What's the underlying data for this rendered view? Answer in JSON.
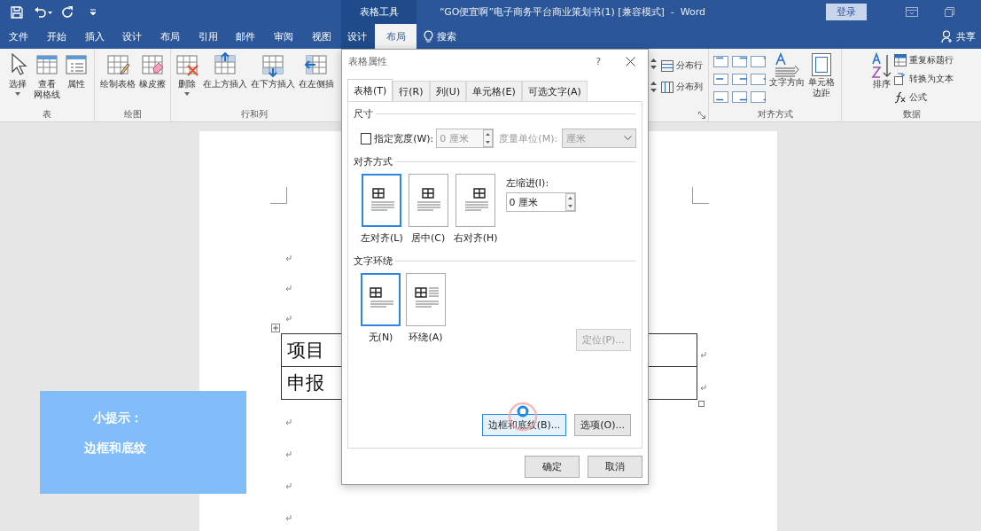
{
  "title_bar": {
    "contextual_header": "表格工具",
    "document_title": "“GO便宜啊”电子商务平台商业策划书(1) [兼容模式]  -  Word",
    "sign_in": "登录"
  },
  "tabs": [
    {
      "label": "文件",
      "selected": false
    },
    {
      "label": "开始",
      "selected": false
    },
    {
      "label": "插入",
      "selected": false
    },
    {
      "label": "设计",
      "selected": false
    },
    {
      "label": "布局",
      "selected": false
    },
    {
      "label": "引用",
      "selected": false
    },
    {
      "label": "邮件",
      "selected": false
    },
    {
      "label": "审阅",
      "selected": false
    },
    {
      "label": "视图",
      "selected": false
    }
  ],
  "contextual_tabs": [
    {
      "label": "设计",
      "selected": false
    },
    {
      "label": "布局",
      "selected": true
    }
  ],
  "tell_me": "搜索",
  "share": "共享",
  "ribbon_left": [
    {
      "label": "表",
      "buttons": [
        {
          "lines": [
            "选择"
          ],
          "dropdown": true
        },
        {
          "lines": [
            "查看",
            "网格线"
          ],
          "dropdown": false
        },
        {
          "lines": [
            "属性"
          ],
          "dropdown": false
        }
      ]
    },
    {
      "label": "绘图",
      "buttons": [
        {
          "lines": [
            "绘制表格"
          ],
          "dropdown": false
        },
        {
          "lines": [
            "橡皮擦"
          ],
          "dropdown": false
        }
      ]
    },
    {
      "label": "行和列",
      "buttons": [
        {
          "lines": [
            "删除"
          ],
          "dropdown": true
        },
        {
          "lines": [
            "在上方插入"
          ],
          "dropdown": false
        },
        {
          "lines": [
            "在下方插入"
          ],
          "dropdown": false
        },
        {
          "lines": [
            "在左侧插"
          ],
          "dropdown": false
        }
      ]
    }
  ],
  "cell_size": {
    "distribute": [
      "分布行",
      "分布列"
    ]
  },
  "alignment": {
    "label": "对齐方式",
    "text_direction": "文字方向",
    "cell_margins": [
      "单元格",
      "边距"
    ]
  },
  "data_group": {
    "label": "数据",
    "sort": "排序",
    "items": [
      "重复标题行",
      "转换为文本",
      "公式"
    ]
  },
  "document": {
    "table_rows": [
      "项目",
      "申报"
    ]
  },
  "tip": {
    "title": "小提示：",
    "text": "边框和底纹"
  },
  "dialog": {
    "title": "表格属性",
    "help": "?",
    "tabs": [
      {
        "label": "表格(T)",
        "selected": true
      },
      {
        "label": "行(R)",
        "selected": false
      },
      {
        "label": "列(U)",
        "selected": false
      },
      {
        "label": "单元格(E)",
        "selected": false
      },
      {
        "label": "可选文字(A)",
        "selected": false
      }
    ],
    "size": {
      "heading": "尺寸",
      "width_label": "指定宽度(W):",
      "checked": false,
      "width_value": "0 厘米",
      "unit_label": "度量单位(M):",
      "unit_value": "厘米",
      "disabled": true
    },
    "alignment": {
      "heading": "对齐方式",
      "options": [
        {
          "label": "左对齐(L)",
          "selected": true
        },
        {
          "label": "居中(C)",
          "selected": false
        },
        {
          "label": "右对齐(H)",
          "selected": false
        }
      ],
      "indent_label": "左缩进(I):",
      "indent_value": "0 厘米"
    },
    "wrapping": {
      "heading": "文字环绕",
      "options": [
        {
          "label": "无(N)",
          "selected": true
        },
        {
          "label": "环绕(A)",
          "selected": false
        }
      ]
    },
    "position_button": {
      "label": "定位(P)...",
      "disabled": true
    },
    "buttons": [
      {
        "label": "边框和底纹(B)...",
        "focused": true
      },
      {
        "label": "选项(O)...",
        "focused": false
      }
    ],
    "footer_buttons": [
      "确定",
      "取消"
    ]
  }
}
